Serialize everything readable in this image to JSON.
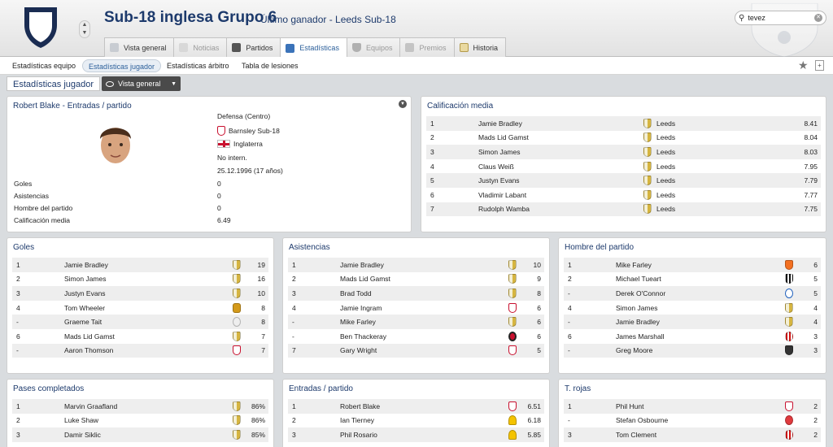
{
  "header": {
    "title": "Sub-18 inglesa Grupo 6",
    "subtitle": "Último ganador - Leeds Sub-18",
    "search_value": "tevez"
  },
  "tabs": [
    {
      "label": "Vista general",
      "icon": "overview-icon"
    },
    {
      "label": "Noticias",
      "icon": "news-icon"
    },
    {
      "label": "Partidos",
      "icon": "calendar-icon"
    },
    {
      "label": "Estadísticas",
      "icon": "stats-icon"
    },
    {
      "label": "Equipos",
      "icon": "shield-icon"
    },
    {
      "label": "Premios",
      "icon": "trophy-icon"
    },
    {
      "label": "Historia",
      "icon": "history-icon"
    }
  ],
  "subnav": [
    "Estadísticas equipo",
    "Estadísticas jugador",
    "Estadísticas árbitro",
    "Tabla de lesiones"
  ],
  "view": {
    "label": "Estadísticas jugador",
    "dropdown": "Vista general"
  },
  "profile": {
    "title": "Robert Blake - Entradas / partido",
    "position": "Defensa (Centro)",
    "club": "Barnsley Sub-18",
    "nation": "Inglaterra",
    "international": "No intern.",
    "dob": "25.12.1996 (17 años)",
    "stats": [
      {
        "label": "Goles",
        "value": "0"
      },
      {
        "label": "Asistencias",
        "value": "0"
      },
      {
        "label": "Hombre del partido",
        "value": "0"
      },
      {
        "label": "Calificación media",
        "value": "6.49"
      }
    ]
  },
  "avg_rating": {
    "title": "Calificación media",
    "rows": [
      {
        "rank": "1",
        "name": "Jamie Bradley",
        "club": "Leeds",
        "value": "8.41"
      },
      {
        "rank": "2",
        "name": "Mads Lid Gamst",
        "club": "Leeds",
        "value": "8.04"
      },
      {
        "rank": "3",
        "name": "Simon James",
        "club": "Leeds",
        "value": "8.03"
      },
      {
        "rank": "4",
        "name": "Claus Weiß",
        "club": "Leeds",
        "value": "7.95"
      },
      {
        "rank": "5",
        "name": "Justyn Evans",
        "club": "Leeds",
        "value": "7.79"
      },
      {
        "rank": "6",
        "name": "Vladimir Labant",
        "club": "Leeds",
        "value": "7.77"
      },
      {
        "rank": "7",
        "name": "Rudolph Wamba",
        "club": "Leeds",
        "value": "7.75"
      }
    ]
  },
  "goals": {
    "title": "Goles",
    "rows": [
      {
        "rank": "1",
        "name": "Jamie Bradley",
        "crest": "leeds",
        "value": "19"
      },
      {
        "rank": "2",
        "name": "Simon James",
        "crest": "leeds",
        "value": "16"
      },
      {
        "rank": "3",
        "name": "Justyn Evans",
        "crest": "leeds",
        "value": "10"
      },
      {
        "rank": "4",
        "name": "Tom Wheeler",
        "crest": "hull",
        "value": "8"
      },
      {
        "rank": "-",
        "name": "Graeme Tait",
        "crest": "swansea",
        "value": "8"
      },
      {
        "rank": "6",
        "name": "Mads Lid Gamst",
        "crest": "leeds",
        "value": "7"
      },
      {
        "rank": "-",
        "name": "Aaron Thomson",
        "crest": "boro",
        "value": "7"
      }
    ]
  },
  "assists": {
    "title": "Asistencias",
    "rows": [
      {
        "rank": "1",
        "name": "Jamie Bradley",
        "crest": "leeds",
        "value": "10"
      },
      {
        "rank": "2",
        "name": "Mads Lid Gamst",
        "crest": "leeds",
        "value": "9"
      },
      {
        "rank": "3",
        "name": "Brad Todd",
        "crest": "leeds",
        "value": "8"
      },
      {
        "rank": "4",
        "name": "Jamie Ingram",
        "crest": "boro",
        "value": "6"
      },
      {
        "rank": "-",
        "name": "Mike Farley",
        "crest": "leeds",
        "value": "6"
      },
      {
        "rank": "-",
        "name": "Ben Thackeray",
        "crest": "sheff",
        "value": "6"
      },
      {
        "rank": "7",
        "name": "Gary Wright",
        "crest": "boro",
        "value": "5"
      }
    ]
  },
  "motm": {
    "title": "Hombre del partido",
    "rows": [
      {
        "rank": "1",
        "name": "Mike Farley",
        "crest": "blackpool",
        "value": "6"
      },
      {
        "rank": "2",
        "name": "Michael Tueart",
        "crest": "newcastle",
        "value": "5"
      },
      {
        "rank": "-",
        "name": "Derek O'Connor",
        "crest": "brighton",
        "value": "5"
      },
      {
        "rank": "4",
        "name": "Simon James",
        "crest": "leeds",
        "value": "4"
      },
      {
        "rank": "-",
        "name": "Jamie Bradley",
        "crest": "leeds",
        "value": "4"
      },
      {
        "rank": "6",
        "name": "James Marshall",
        "crest": "sunder",
        "value": "3"
      },
      {
        "rank": "-",
        "name": "Greg Moore",
        "crest": "grimsby",
        "value": "3"
      }
    ]
  },
  "passes": {
    "title": "Pases completados",
    "rows": [
      {
        "rank": "1",
        "name": "Marvin Graafland",
        "crest": "leeds",
        "value": "86%"
      },
      {
        "rank": "2",
        "name": "Luke Shaw",
        "crest": "leeds",
        "value": "86%"
      },
      {
        "rank": "3",
        "name": "Damir Siklic",
        "crest": "leeds",
        "value": "85%"
      }
    ]
  },
  "tackles": {
    "title": "Entradas / partido",
    "rows": [
      {
        "rank": "1",
        "name": "Robert Blake",
        "crest": "barnsley",
        "value": "6.51"
      },
      {
        "rank": "2",
        "name": "Ian Tierney",
        "crest": "burton",
        "value": "6.18"
      },
      {
        "rank": "3",
        "name": "Phil Rosario",
        "crest": "burton",
        "value": "5.85"
      }
    ]
  },
  "reds": {
    "title": "T. rojas",
    "rows": [
      {
        "rank": "1",
        "name": "Phil Hunt",
        "crest": "barnsley",
        "value": "2"
      },
      {
        "rank": "-",
        "name": "Stefan Osbourne",
        "crest": "stoke",
        "value": "2"
      },
      {
        "rank": "3",
        "name": "Tom Clement",
        "crest": "sunder",
        "value": "2"
      }
    ]
  }
}
